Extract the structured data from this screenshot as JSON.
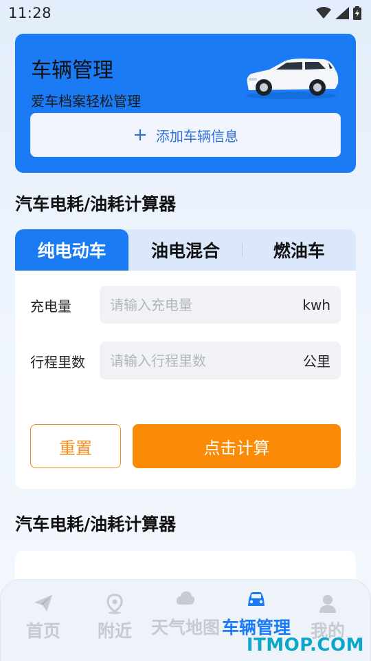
{
  "status_bar": {
    "time": "11:28"
  },
  "hero": {
    "title": "车辆管理",
    "subtitle": "爱车档案轻松管理",
    "add_button": {
      "icon": "plus-icon",
      "label": "添加车辆信息"
    },
    "car_image": "suv-car-illustration"
  },
  "calculator": {
    "title": "汽车电耗/油耗计算器",
    "tabs": [
      {
        "label": "纯电动车",
        "active": true
      },
      {
        "label": "油电混合",
        "active": false
      },
      {
        "label": "燃油车",
        "active": false
      }
    ],
    "fields": [
      {
        "label": "充电量",
        "placeholder": "请输入充电量",
        "unit": "kwh"
      },
      {
        "label": "行程里数",
        "placeholder": "请输入行程里数",
        "unit": "公里"
      }
    ],
    "reset_label": "重置",
    "calc_label": "点击计算"
  },
  "result_section": {
    "title": "汽车电耗/油耗计算器"
  },
  "bottom_nav": [
    {
      "label": "首页",
      "icon": "paper-plane-icon",
      "active": false
    },
    {
      "label": "附近",
      "icon": "location-pin-icon",
      "active": false
    },
    {
      "label": "天气地图",
      "icon": "cloud-icon",
      "active": false
    },
    {
      "label": "车辆管理",
      "icon": "car-icon",
      "active": true
    },
    {
      "label": "我的",
      "icon": "user-icon",
      "active": false
    }
  ],
  "watermark": "ITMOP.COM",
  "colors": {
    "primary": "#1a7bf5",
    "accent_orange": "#fb8a06",
    "background": "#eef4fd"
  }
}
